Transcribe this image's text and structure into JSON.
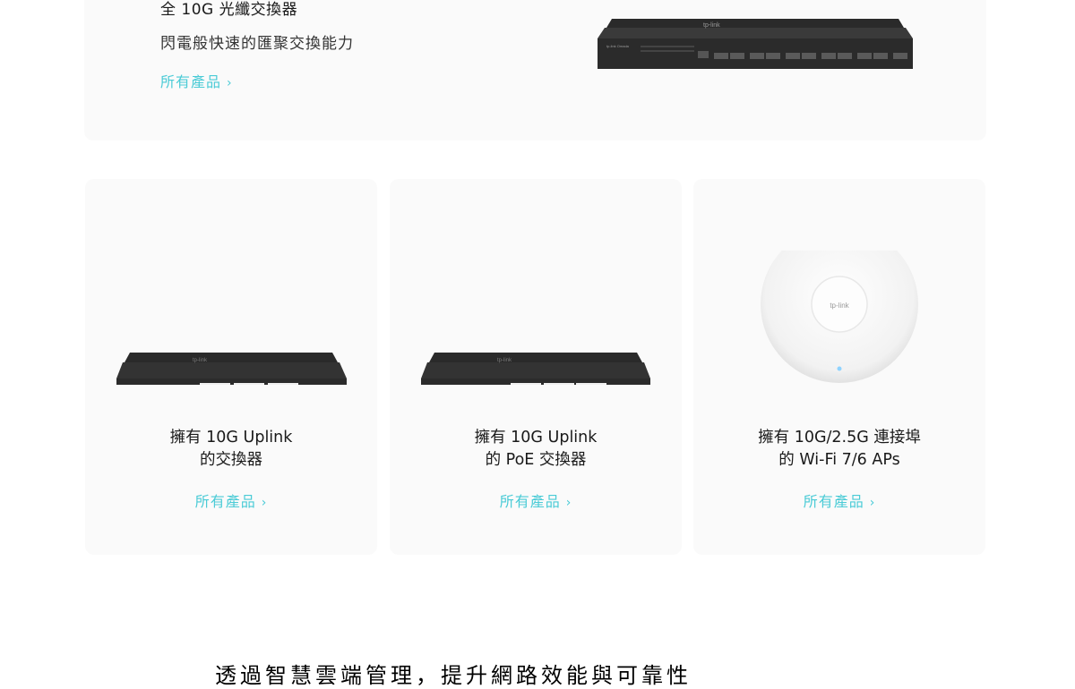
{
  "hero": {
    "title": "全 10G 光纖交換器",
    "subtitle": "閃電般快速的匯聚交換能力",
    "link": "所有產品",
    "chevron": "›"
  },
  "cards": [
    {
      "title_line1": "擁有 10G Uplink",
      "title_line2": "的交換器",
      "link": "所有產品",
      "chevron": "›"
    },
    {
      "title_line1": "擁有 10G Uplink",
      "title_line2": "的 PoE 交換器",
      "link": "所有產品",
      "chevron": "›"
    },
    {
      "title_line1": "擁有 10G/2.5G 連接埠",
      "title_line2": "的 Wi-Fi 7/6 APs",
      "link": "所有產品",
      "chevron": "›"
    }
  ],
  "logos": {
    "brand": "tp-link",
    "series": "Omada"
  },
  "bottom": {
    "text": "透過智慧雲端管理，提升網路效能與可靠性"
  },
  "colors": {
    "accent": "#4acbd6",
    "card_bg": "#fafafa",
    "device": "#2b2b2b"
  }
}
